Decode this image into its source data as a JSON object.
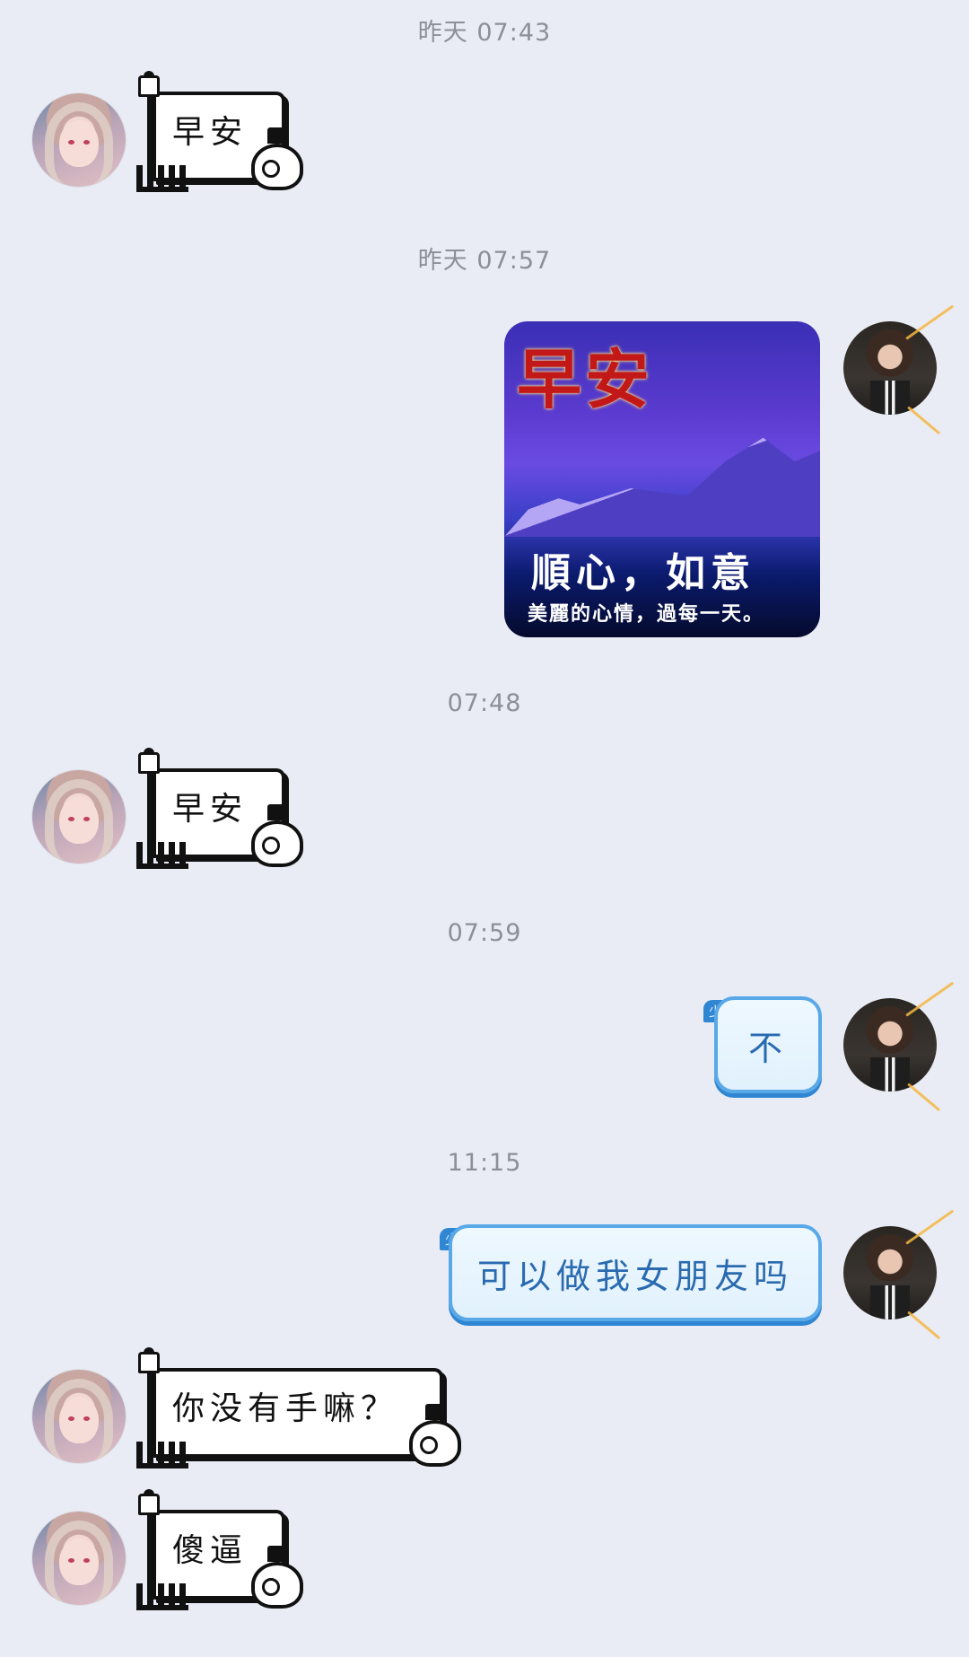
{
  "timestamps": [
    "昨天 07:43",
    "昨天 07:57",
    "07:48",
    "07:59",
    "11:15"
  ],
  "messages": {
    "m1": {
      "sender": "left",
      "type": "sticker",
      "text": "早安"
    },
    "m2": {
      "sender": "right",
      "type": "image",
      "title": "早安",
      "line1": "順心，如意",
      "line2": "美麗的心情，過每一天。"
    },
    "m3": {
      "sender": "left",
      "type": "sticker",
      "text": "早安"
    },
    "m4": {
      "sender": "right",
      "type": "text",
      "badge": "少先队员",
      "text": "不"
    },
    "m5": {
      "sender": "right",
      "type": "text",
      "badge": "少先队员",
      "text": "可以做我女朋友吗"
    },
    "m6": {
      "sender": "left",
      "type": "sticker",
      "text": "你没有手嘛？"
    },
    "m7": {
      "sender": "left",
      "type": "sticker",
      "text": "傻逼"
    }
  },
  "colors": {
    "background": "#e9ecf4",
    "bubble_border": "#59a8e8",
    "timestamp": "#8d8f98"
  }
}
